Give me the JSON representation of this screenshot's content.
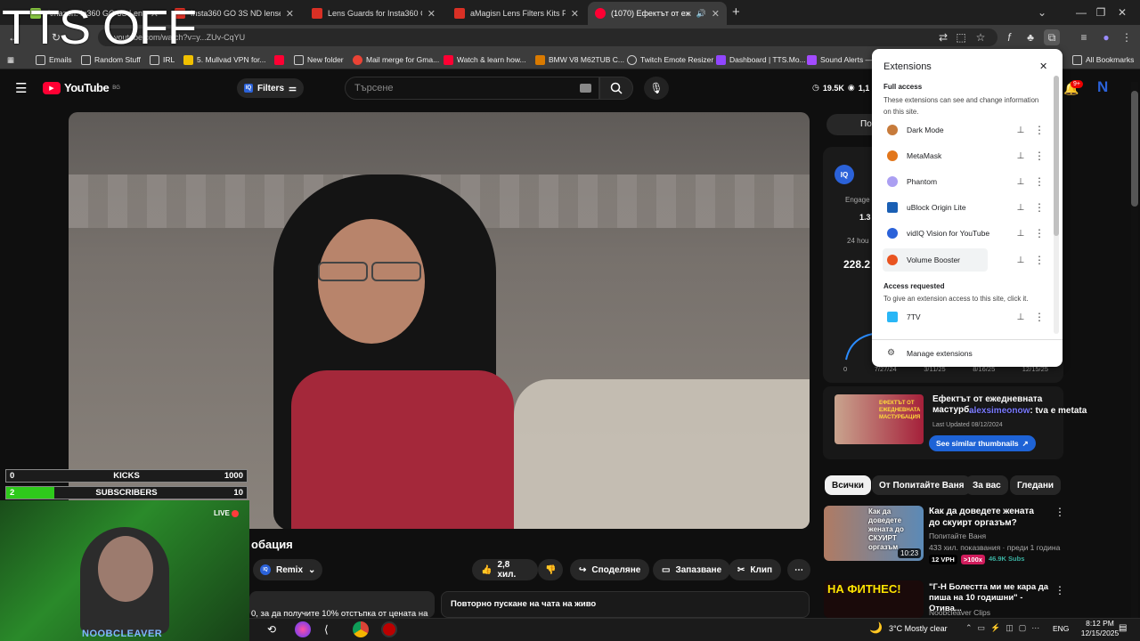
{
  "overlay": {
    "tts": "TTS OFF",
    "kicks": {
      "left": "0",
      "label": "KICKS",
      "right": "1000"
    },
    "subs": {
      "left": "2",
      "label": "SUBSCRIBERS",
      "right": "10"
    },
    "live": "LIVE",
    "cam_name": "NOOBCLEAVER"
  },
  "tabs": [
    {
      "title": "Amazon: In360 GO 3S Lenses",
      "color": "#86c440"
    },
    {
      "title": "Insta360 GO 3S ND lense guard",
      "color": "#d93025"
    },
    {
      "title": "Lens Guards for Insta360 GO 3S",
      "color": "#d93025"
    },
    {
      "title": "aMagisn Lens Filters Kits For 360",
      "color": "#d93025"
    },
    {
      "title": "(1070) Ефектът от ежедне...",
      "color": "#ff0033"
    }
  ],
  "omnibox": {
    "url": "youtube.com/watch?v=y...ZUv-CqYU"
  },
  "bookmarks": [
    {
      "label": "Emails"
    },
    {
      "label": "Random Stuff"
    },
    {
      "label": "IRL"
    },
    {
      "label": "5. Mullvad VPN for..."
    },
    {
      "label": ""
    },
    {
      "label": "New folder"
    },
    {
      "label": "Mail merge for Gma..."
    },
    {
      "label": "Watch & learn how..."
    },
    {
      "label": "BMW V8 M62TUB C..."
    },
    {
      "label": "Twitch Emote Resizer"
    },
    {
      "label": "Dashboard | TTS.Mo..."
    },
    {
      "label": "Sound Alerts —"
    },
    {
      "label": "All Bookmarks"
    }
  ],
  "youtube": {
    "logo": "YouTube",
    "region": "BG",
    "filters": "Filters",
    "search_placeholder": "Търсене",
    "stats_views": "19.5K",
    "stats_other": "1,1",
    "notif_badge": "9+",
    "avatar": "N"
  },
  "video": {
    "title_fragment": "обация",
    "remix": "Remix",
    "likes": "2,8 хил.",
    "share": "Споделяне",
    "save": "Запазване",
    "clip": "Клип",
    "description": "0, за да получите 10% отстъпка от цената на",
    "chat_replay": "Повторно пускане на чата на живо"
  },
  "extensions": {
    "title": "Extensions",
    "full_access_heading": "Full access",
    "full_access_desc": "These extensions can see and change information on this site.",
    "full_access": [
      {
        "name": "Dark Mode",
        "color": "#c77b3b"
      },
      {
        "name": "MetaMask",
        "color": "#e2761b"
      },
      {
        "name": "Phantom",
        "color": "#ab9ff2"
      },
      {
        "name": "uBlock Origin Lite",
        "color": "#1a5fb4"
      },
      {
        "name": "vidIQ Vision for YouTube",
        "color": "#2b62d9"
      },
      {
        "name": "Volume Booster",
        "color": "#e95420"
      }
    ],
    "access_requested_heading": "Access requested",
    "access_requested_desc": "To give an extension access to this site, click it.",
    "requested": [
      {
        "name": "7TV",
        "color": "#29b6f6"
      }
    ],
    "manage": "Manage extensions"
  },
  "vidiq": {
    "engage": "Engage",
    "engage_val": "1.3",
    "hours": "24 hou",
    "big": "228.2",
    "axis": [
      "0",
      "7/27/24",
      "3/11/25",
      "8/16/25",
      "12/15/25"
    ]
  },
  "thumb_card": {
    "title": "Ефектът от ежедневната мастурб...",
    "chat_user": "alexsimeonow",
    "chat_msg": ": tva e metata",
    "updated": "Last Updated 08/12/2024",
    "button": "See similar thumbnails",
    "thumb_text": "ЕФЕКТЪТ ОТ ЕЖЕДНЕВНАТА МАСТУРБАЦИЯ"
  },
  "chips": [
    "Всички",
    "От Попитайте Ваня",
    "За вас",
    "Гледани"
  ],
  "related": [
    {
      "title": "Как да доведете жената до скуирт оргазъм?",
      "channel": "Попитайте Ваня",
      "meta": "433 хил. показвания · преди 1 година",
      "duration": "10:23",
      "vph": "12 VPH",
      "mult": ">100x",
      "subs": "46.9K Subs",
      "thumb_text": "Как да доведете жената до СКУИРТ оргазъм"
    },
    {
      "title": "\"Г-Н Болестта ми ме кара да пиша на 10 годишни\" - Отива...",
      "channel": "Noobcleaver Clips",
      "meta": "",
      "duration": "",
      "vph": "",
      "mult": "",
      "subs": "",
      "thumb_text": "НА ФИТНЕС!"
    }
  ],
  "taskbar": {
    "weather": "3°C  Mostly clear",
    "lang": "ENG",
    "time": "8:12 PM",
    "date": "12/15/2025"
  }
}
